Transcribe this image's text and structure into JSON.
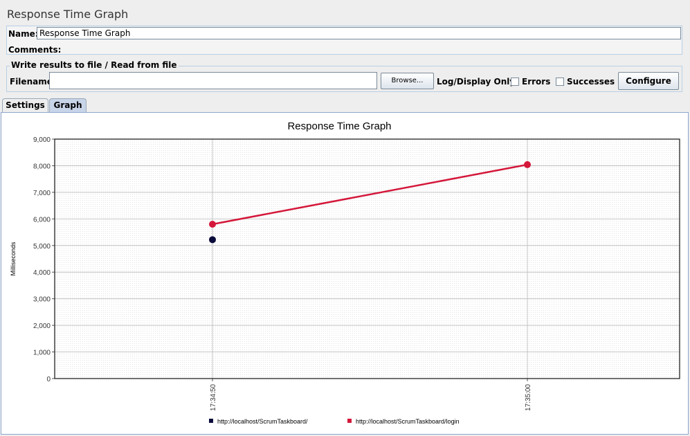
{
  "window": {
    "title": "Response Time Graph"
  },
  "form": {
    "name_label": "Name:",
    "name_value": "Response Time Graph",
    "comments_label": "Comments:"
  },
  "file_group": {
    "title": "Write results to file / Read from file",
    "filename_label": "Filename",
    "filename_value": "",
    "browse_label": "Browse...",
    "log_display_label": "Log/Display Only:",
    "errors_label": "Errors",
    "successes_label": "Successes",
    "configure_label": "Configure",
    "errors_checked": false,
    "successes_checked": false
  },
  "tabs": [
    {
      "label": "Settings",
      "active": false
    },
    {
      "label": "Graph",
      "active": true
    }
  ],
  "colors": {
    "series1": "#0b0b3b",
    "series2": "#d4173a",
    "accent": "#8ea6cc"
  },
  "chart_data": {
    "type": "line",
    "title": "Response Time Graph",
    "xlabel": "",
    "ylabel": "Milliseconds",
    "ylim": [
      0,
      9000
    ],
    "yticks": [
      "0",
      "1,000",
      "2,000",
      "3,000",
      "4,000",
      "5,000",
      "6,000",
      "7,000",
      "8,000",
      "9,000"
    ],
    "categories": [
      "17:34:50",
      "17:35:00"
    ],
    "series": [
      {
        "name": "http://localhost/ScrumTaskboard/",
        "values": [
          5220,
          null
        ]
      },
      {
        "name": "http://localhost/ScrumTaskboard/login",
        "values": [
          5800,
          8040
        ]
      }
    ],
    "grid": true,
    "legend": "bottom"
  }
}
